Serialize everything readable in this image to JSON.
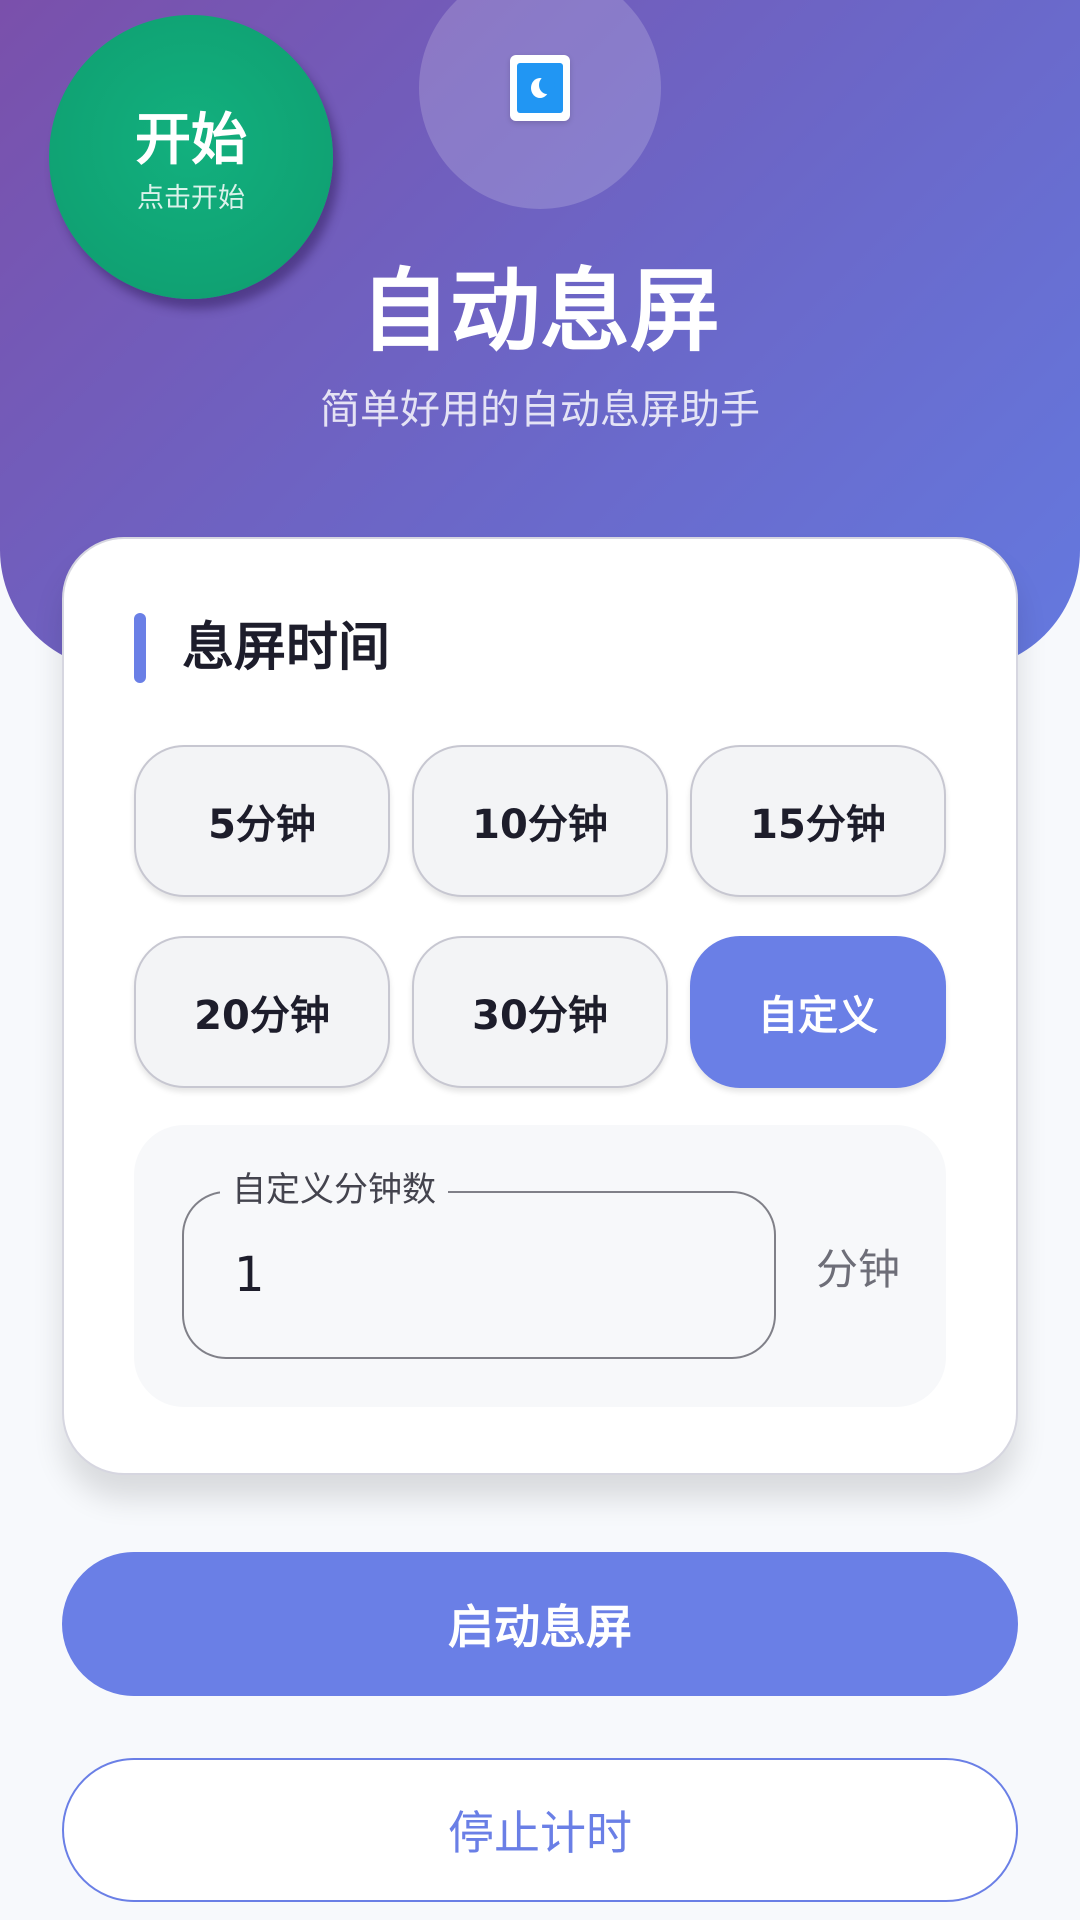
{
  "header": {
    "title": "自动息屏",
    "subtitle": "简单好用的自动息屏助手",
    "app_icon": "moon-app-icon"
  },
  "fab": {
    "label": "开始",
    "sub_label": "点击开始",
    "color": "#10a273"
  },
  "timer_card": {
    "title": "息屏时间",
    "options": [
      {
        "label": "5分钟",
        "selected": false
      },
      {
        "label": "10分钟",
        "selected": false
      },
      {
        "label": "15分钟",
        "selected": false
      },
      {
        "label": "20分钟",
        "selected": false
      },
      {
        "label": "30分钟",
        "selected": false
      },
      {
        "label": "自定义",
        "selected": true
      }
    ],
    "custom": {
      "field_label": "自定义分钟数",
      "value": "1",
      "unit": "分钟"
    }
  },
  "actions": {
    "start_label": "启动息屏",
    "stop_label": "停止计时"
  },
  "colors": {
    "accent": "#6a7fe6",
    "fab_green": "#10a273",
    "header_start": "#7a50ab",
    "header_end": "#6479df"
  }
}
